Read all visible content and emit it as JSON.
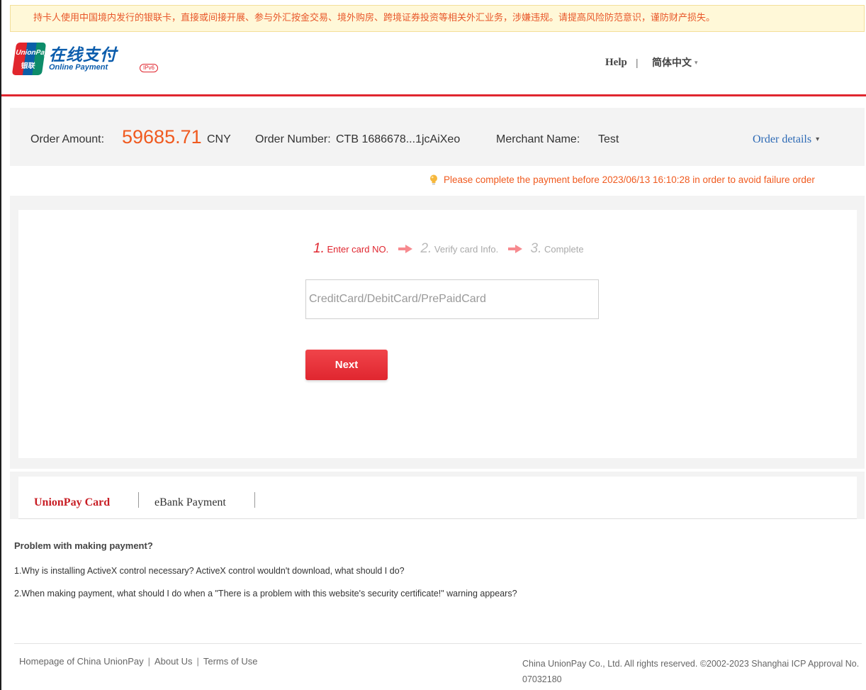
{
  "banner": {
    "text": "持卡人使用中国境内发行的银联卡，直接或间接开展、参与外汇按金交易、境外购房、跨境证券投资等相关外汇业务，涉嫌违规。请提高风险防范意识，谨防财产损失。"
  },
  "header": {
    "logo_badge_line1": "UnionPay",
    "logo_badge_line2": "银联",
    "logo_cn": "在线支付",
    "logo_en": "Online Payment",
    "logo_tag": "IPv6",
    "help_label": "Help",
    "separator": "|",
    "language_label": "简体中文",
    "language_caret": "▾"
  },
  "order": {
    "amount_label": "Order Amount:",
    "amount_value": "59685.71",
    "currency": "CNY",
    "number_label": "Order Number:",
    "number_value": "CTB 1686678...1jcAiXeo",
    "merchant_label": "Merchant Name:",
    "merchant_value": "Test",
    "details_label": "Order details",
    "details_caret": "▾"
  },
  "reminder": {
    "text": "Please complete the payment before 2023/06/13 16:10:28 in order to avoid failure order"
  },
  "steps": [
    {
      "num": "1.",
      "label": "Enter card NO."
    },
    {
      "num": "2.",
      "label": "Verify card Info."
    },
    {
      "num": "3.",
      "label": "Complete"
    }
  ],
  "card_input": {
    "placeholder": "CreditCard/DebitCard/PrePaidCard",
    "value": ""
  },
  "next_button": {
    "label": "Next"
  },
  "tabs": [
    {
      "label": "UnionPay Card",
      "active": true
    },
    {
      "label": "eBank Payment",
      "active": false
    }
  ],
  "faq": {
    "title": "Problem with making payment?",
    "items": [
      "1.Why is installing ActiveX control necessary? ActiveX control wouldn't download, what should I do?",
      "2.When making payment, what should I do when a \"There is a problem with this website's security certificate!\" warning appears?"
    ]
  },
  "footer": {
    "links": [
      "Homepage of China UnionPay",
      "About Us",
      "Terms of Use"
    ],
    "copyright": "China UnionPay Co., Ltd. All rights reserved. ©2002-2023 Shanghai ICP Approval No. 07032180"
  },
  "colors": {
    "accent_red": "#e0262f",
    "amount_orange": "#f05a1f",
    "link_blue": "#2d6ab5",
    "brand_blue": "#0b5cac"
  },
  "icons": [
    "bulb-icon",
    "step-arrow-icon",
    "caret-down-icon"
  ]
}
